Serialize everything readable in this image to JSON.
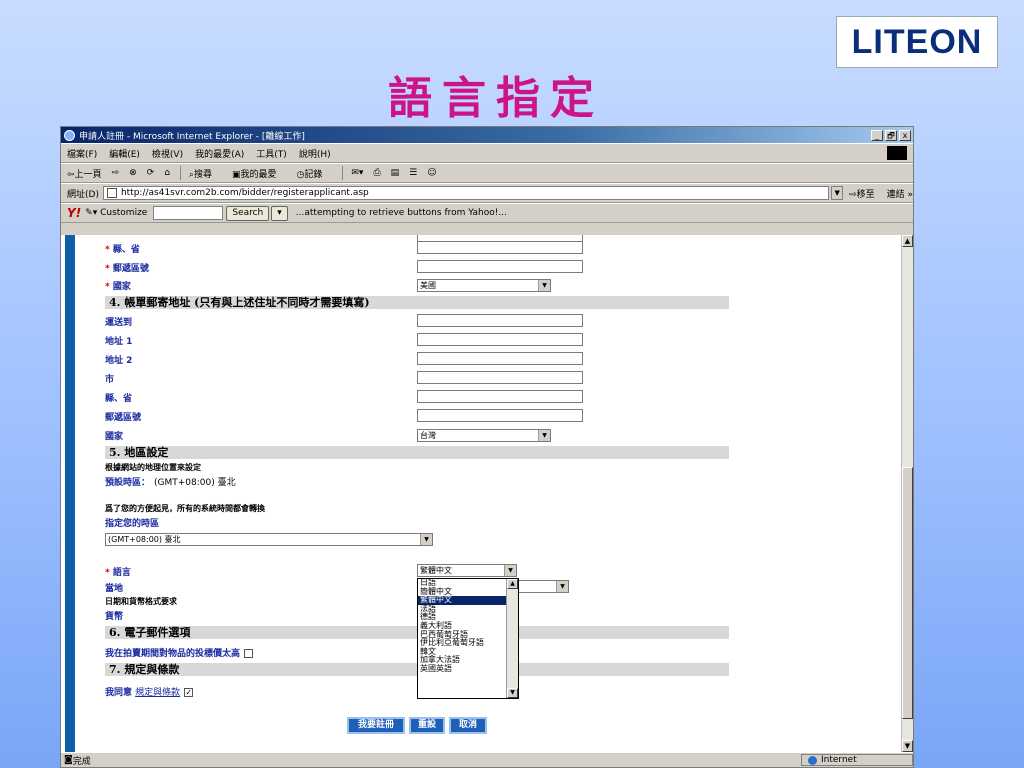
{
  "slide": {
    "title": "語言指定",
    "logo_text": "LITEON"
  },
  "browser": {
    "title": "申請人註冊 - Microsoft Internet Explorer - [離線工作]",
    "controls": [
      "_",
      "🗗",
      "x"
    ],
    "menu": [
      "檔案(F)",
      "編輯(E)",
      "檢視(V)",
      "我的最愛(A)",
      "工具(T)",
      "說明(H)"
    ],
    "toolbar": {
      "back": "⇦上一頁",
      "forward": "⇨",
      "search": "搜尋",
      "favorites": "我的最愛",
      "history": "記錄"
    },
    "address": {
      "label": "網址(D)",
      "url": "http://as41svr.com2b.com/bidder/registerapplicant.asp",
      "go": "移至",
      "links": "連結 »"
    },
    "yahoo": {
      "logo": "Y!",
      "customize": "▾ Customize",
      "search_button": "Search",
      "message": "...attempting to retrieve buttons from Yahoo!..."
    },
    "status": {
      "text": "完成",
      "zone": "Internet"
    }
  },
  "form": {
    "fields_top": [
      {
        "label": "縣、省",
        "required": true
      },
      {
        "label": "郵遞區號",
        "required": true
      },
      {
        "label": "國家",
        "required": true,
        "value": "美國"
      }
    ],
    "section4": {
      "title": "4. 帳單郵寄地址 (只有與上述住址不同時才需要填寫)"
    },
    "fields_billing": [
      {
        "label": "運送到"
      },
      {
        "label": "地址 1"
      },
      {
        "label": "地址 2"
      },
      {
        "label": "市"
      },
      {
        "label": "縣、省"
      },
      {
        "label": "郵遞區號"
      },
      {
        "label": "國家",
        "value": "台灣"
      }
    ],
    "section5": {
      "title": "5. 地區設定",
      "note1": "根據網站的地理位置來設定",
      "default_tz_label": "預設時區：",
      "default_tz_value": "(GMT+08:00) 臺北",
      "note2": "爲了您的方便起見，所有的系統時間都會轉換",
      "tz_label": "指定您的時區",
      "tz_value": "(GMT+08:00) 臺北",
      "lang_label": "語言",
      "lang_value": "繁體中文",
      "locale_label": "當地",
      "date_label": "日期和貨幣格式要求",
      "currency_label": "貨幣",
      "language_options": [
        "日語",
        "簡體中文",
        "繁體中文",
        "法語",
        "德語",
        "義大利語",
        "巴西葡萄牙語",
        "伊比利亞葡萄牙語",
        "韓文",
        "加拿大法語",
        "英國英語"
      ],
      "selected_index": 2
    },
    "section6": {
      "title": "6. 電子郵件選項",
      "label": "我在拍賣期間對物品的投標價太高"
    },
    "section7": {
      "title": "7. 規定與條款",
      "agree": "我同意",
      "link": "規定與條款",
      "checked": "✓"
    },
    "buttons": {
      "register": "我要註冊",
      "reset": "重設",
      "cancel": "取消"
    }
  }
}
